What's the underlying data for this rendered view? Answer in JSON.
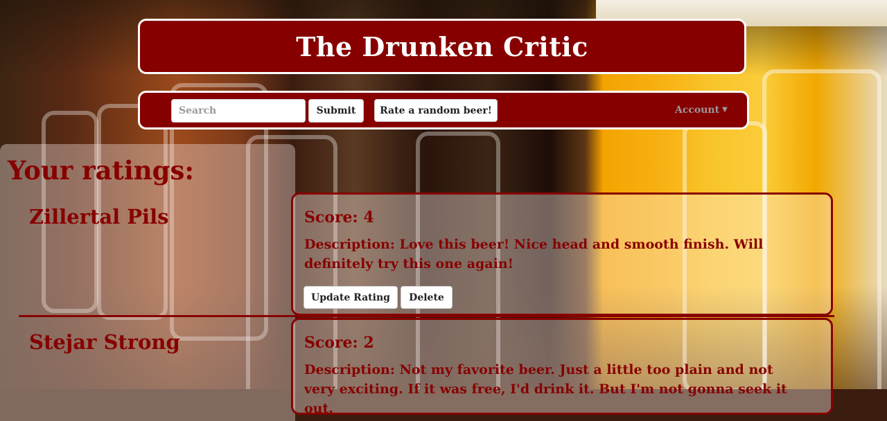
{
  "header": {
    "title": "The Drunken Critic"
  },
  "nav": {
    "search_placeholder": "Search",
    "submit_label": "Submit",
    "random_label": "Rate a random beer!",
    "account_label": "Account"
  },
  "ratings": {
    "heading": "Your ratings:",
    "items": [
      {
        "name": "Zillertal Pils",
        "score": "Score: 4",
        "description": "Description: Love this beer! Nice head and smooth finish. Will definitely try this one again!",
        "update_label": "Update Rating",
        "delete_label": "Delete"
      },
      {
        "name": "Stejar Strong",
        "score": "Score: 2",
        "description": "Description: Not my favorite beer. Just a little too plain and not very exciting. If it was free, I'd drink it. But I'm not gonna seek it out."
      }
    ]
  },
  "colors": {
    "brand": "#870000",
    "text_light": "#ffffff"
  },
  "icons": {
    "account_caret": "caret-down-icon"
  }
}
